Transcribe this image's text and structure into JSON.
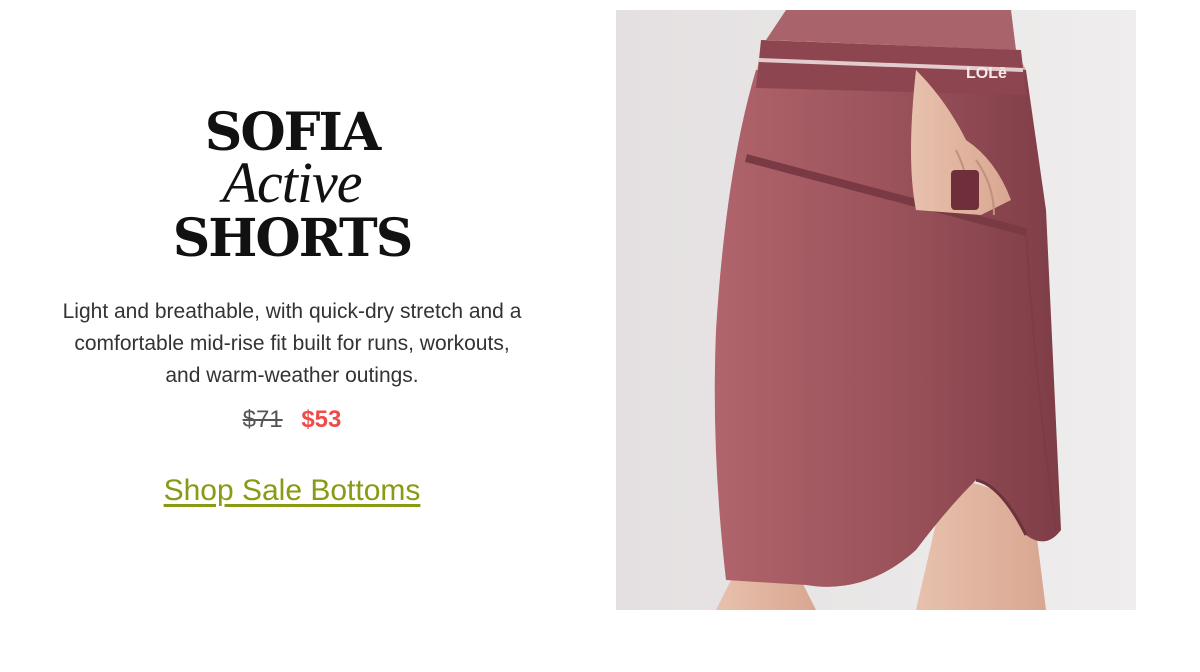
{
  "hero": {
    "title_line1": "SOFIA",
    "title_line2": "Active",
    "title_line3": "SHORTS",
    "description": "Light and breathable, with quick-dry stretch and a comfortable mid-rise fit built for runs, workouts, and warm-weather outings.",
    "old_price": "$71",
    "sale_price": "$53",
    "cta_label": "Shop Sale Bottoms"
  },
  "photo": {
    "waistband_logo": "LOLē"
  },
  "colors": {
    "sale_price": "#f04a4a",
    "cta_link": "#8a9a14",
    "shorts": "#9c535b",
    "background": "#ffffff"
  }
}
